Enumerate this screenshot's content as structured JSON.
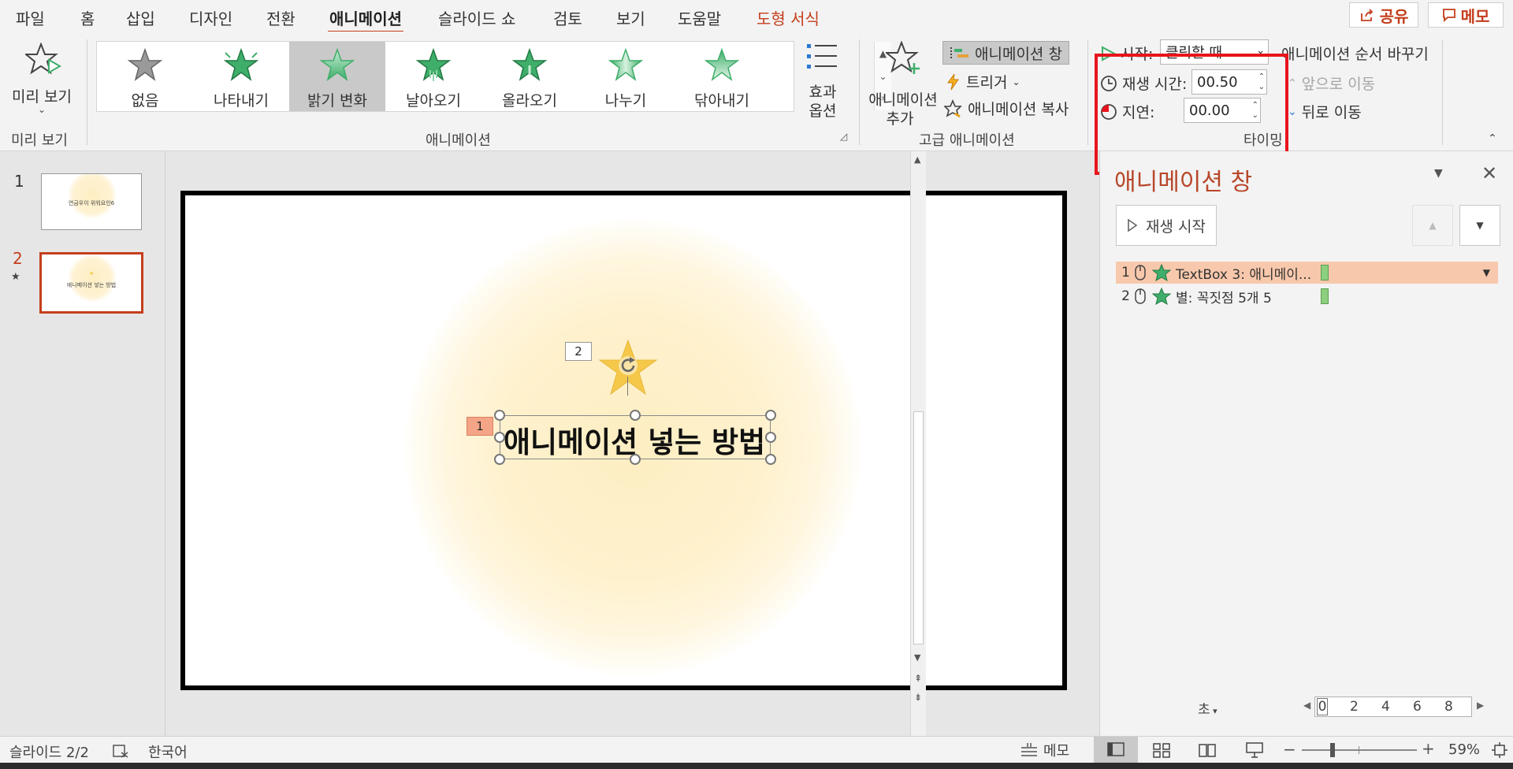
{
  "menu": {
    "tabs": [
      "파일",
      "홈",
      "삽입",
      "디자인",
      "전환",
      "애니메이션",
      "슬라이드 쇼",
      "검토",
      "보기",
      "도움말",
      "도형 서식"
    ],
    "active_tab": "애니메이션",
    "share_label": "공유",
    "memo_label": "메모"
  },
  "ribbon": {
    "preview": {
      "label": "미리 보기",
      "group": "미리 보기"
    },
    "animation_group_label": "애니메이션",
    "gallery": [
      "없음",
      "나타내기",
      "밝기 변화",
      "날아오기",
      "올라오기",
      "나누기",
      "닦아내기"
    ],
    "gallery_selected": "밝기 변화",
    "effect_options": {
      "line1": "효과",
      "line2": "옵션"
    },
    "add_animation": {
      "line1": "애니메이션",
      "line2": "추가"
    },
    "animation_pane_btn": "애니메이션 창",
    "trigger": "트리거",
    "anim_painter": "애니메이션 복사",
    "advanced_group_label": "고급 애니메이션",
    "timing": {
      "start_label": "시작:",
      "start_value": "클릭할 때",
      "duration_label": "재생 시간:",
      "duration_value": "00.50",
      "delay_label": "지연:",
      "delay_value": "00.00",
      "group_label": "타이밍"
    },
    "reorder": {
      "title": "애니메이션 순서 바꾸기",
      "move_earlier": "앞으로 이동",
      "move_later": "뒤로 이동"
    }
  },
  "slides": {
    "items": [
      {
        "number": "1",
        "text": "연금우이 위워요인6"
      },
      {
        "number": "2",
        "text": "애니메이션 넣는 방법"
      }
    ],
    "selected": "2"
  },
  "slide": {
    "title": "애니메이션 넣는 방법",
    "tag_1": "1",
    "tag_2": "2"
  },
  "pane": {
    "title": "애니메이션 창",
    "play_label": "재생 시작",
    "items": [
      {
        "num": "1",
        "text": "TextBox 3: 애니메이..."
      },
      {
        "num": "2",
        "text": "별: 꼭짓점 5개 5"
      }
    ],
    "seconds_label": "초",
    "timeline_ticks": [
      "0",
      "2",
      "4",
      "6",
      "8"
    ]
  },
  "status": {
    "slide_info": "슬라이드 2/2",
    "language": "한국어",
    "notes_label": "메모",
    "zoom": "59%"
  },
  "colors": {
    "accent": "#c43e1c",
    "pane_title": "#b7472a",
    "highlight_box": "#e8141c",
    "selected_row": "#f8c8ac",
    "star_green": "#3fae6a",
    "star_gold": "#f5c84a"
  }
}
